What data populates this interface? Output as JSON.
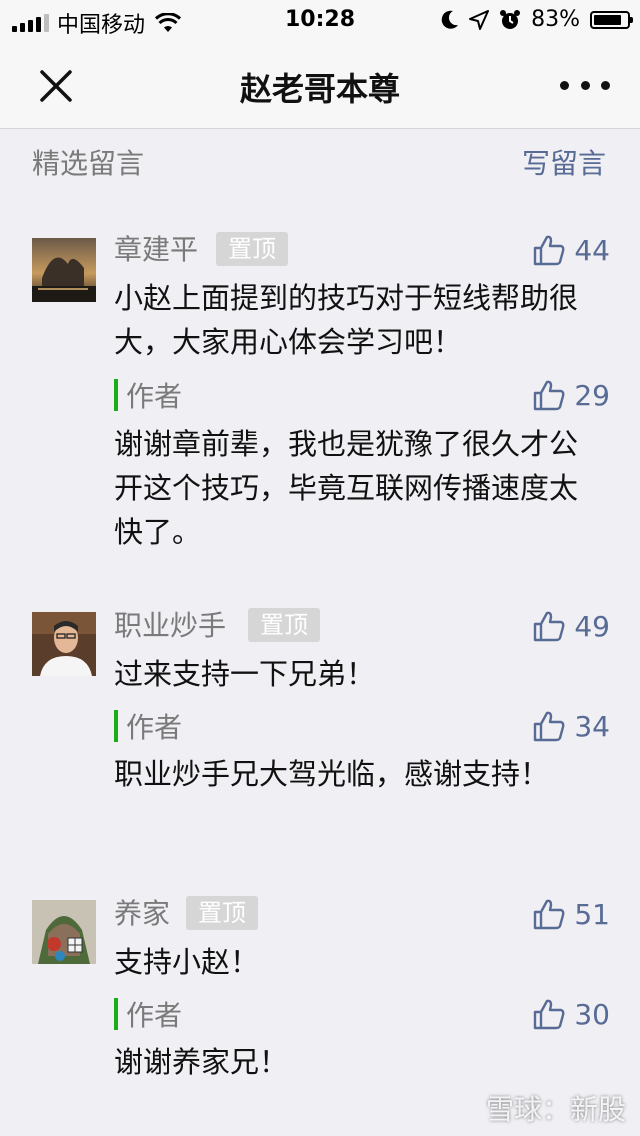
{
  "status_bar": {
    "carrier": "中国移动",
    "time": "10:28",
    "battery_text": "83%",
    "battery_level": 0.83
  },
  "nav": {
    "title": "赵老哥本尊"
  },
  "section": {
    "featured_label": "精选留言",
    "write_label": "写留言"
  },
  "comments": [
    {
      "name": "章建平",
      "pin": "置顶",
      "likes": "44",
      "text": "小赵上面提到的技巧对于短线帮助很大，大家用心体会学习吧！",
      "reply_label": "作者",
      "reply_likes": "29",
      "reply_text": "谢谢章前辈，我也是犹豫了很久才公开这个技巧，毕竟互联网传播速度太快了。"
    },
    {
      "name": "职业炒手",
      "pin": "置顶",
      "likes": "49",
      "text": "过来支持一下兄弟！",
      "reply_label": "作者",
      "reply_likes": "34",
      "reply_text": "职业炒手兄大驾光临，感谢支持！"
    },
    {
      "name": "养家",
      "pin": "置顶",
      "likes": "51",
      "text": "支持小赵！",
      "reply_label": "作者",
      "reply_likes": "30",
      "reply_text": "谢谢养家兄！"
    }
  ],
  "watermark": "雪球：新股",
  "colors": {
    "link": "#576b95",
    "author_bar": "#1aad19",
    "background": "#efeff4"
  }
}
